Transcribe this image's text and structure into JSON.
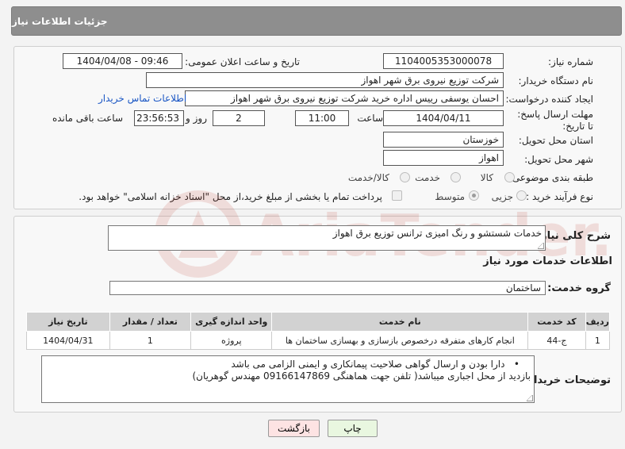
{
  "header": {
    "title": "جزئیات اطلاعات نیاز"
  },
  "form": {
    "need_number_label": "شماره نیاز:",
    "need_number": "1104005353000078",
    "announce_label": "تاریخ و ساعت اعلان عمومی:",
    "announce_value": "1404/04/08 - 09:46",
    "buyer_org_label": "نام دستگاه خریدار:",
    "buyer_org": "شرکت توزیع نیروی برق شهر اهواز",
    "requester_label": "ایجاد کننده درخواست:",
    "requester": "احسان یوسفی رییس اداره خرید شرکت توزیع نیروی برق شهر اهواز",
    "contact_link": "اطلاعات تماس خریدار",
    "deadline_label": "مهلت ارسال پاسخ: تا تاریخ:",
    "deadline_date": "1404/04/11",
    "time_label": "ساعت",
    "deadline_time": "11:00",
    "days_value": "2",
    "days_label": "روز و",
    "remaining_time": "23:56:53",
    "remaining_label": "ساعت باقی مانده",
    "province_label": "استان محل تحویل:",
    "province": "خوزستان",
    "city_label": "شهر محل تحویل:",
    "city": "اهواز",
    "category_label": "طبقه بندی موضوعی:",
    "category_options": [
      "کالا",
      "خدمت",
      "کالا/خدمت"
    ],
    "process_label": "نوع فرآیند خرید :",
    "process_options": [
      "جزیی",
      "متوسط"
    ],
    "payment_note": "پرداخت تمام یا بخشی از مبلغ خرید،از محل \"اسناد خزانه اسلامی\" خواهد بود."
  },
  "details": {
    "description_label": "شرح کلی نیاز:",
    "description": "خدمات شستشو و رنگ امیزی ترانس توزیع برق اهواز",
    "services_heading": "اطلاعات خدمات مورد نیاز",
    "service_group_label": "گروه خدمت:",
    "service_group": "ساختمان",
    "table": {
      "headers": [
        "ردیف",
        "کد خدمت",
        "نام خدمت",
        "واحد اندازه گیری",
        "تعداد / مقدار",
        "تاریخ نیاز"
      ],
      "rows": [
        [
          "1",
          "ج-44",
          "انجام کارهای متفرقه درخصوص بازسازی و بهسازی ساختمان ها",
          "پروژه",
          "1",
          "1404/04/31"
        ]
      ]
    },
    "buyer_notes_label": "توضیحات خریدار:",
    "buyer_notes_line1": "دارا بودن و ارسال گواهی صلاحیت پیمانکاری و ایمنی الزامی می باشد",
    "buyer_notes_line2": "بازدید از محل اجباری میباشد( تلفن جهت هماهنگی 09166147869 مهندس گوهریان)"
  },
  "buttons": {
    "print": "چاپ",
    "back": "بازگشت"
  },
  "watermark": {
    "text": "AriaTender.neT"
  },
  "colors": {
    "header_bg": "#8e8e8e",
    "link": "#1a56c4",
    "back_button_bg": "#fde3e3",
    "print_button_bg": "#e9f7e0",
    "watermark": "#c0392b"
  }
}
